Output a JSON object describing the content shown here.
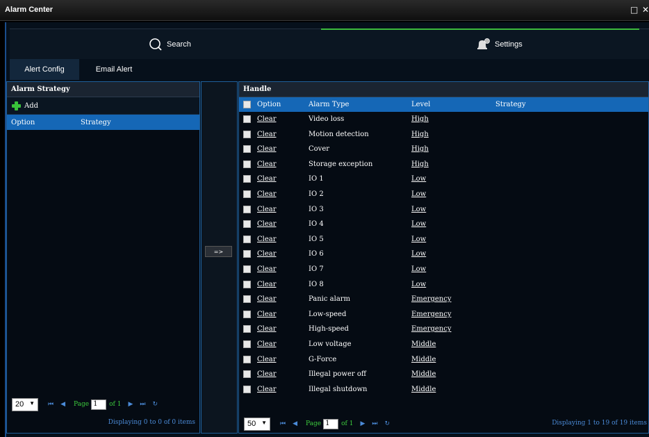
{
  "window": {
    "title": "Alarm Center",
    "maximize_glyph": "□",
    "close_glyph": "✕"
  },
  "nav": {
    "search_label": "Search",
    "settings_label": "Settings",
    "search_icon": "search-icon",
    "settings_icon": "bell-gear-icon",
    "active": "settings"
  },
  "tabs": [
    {
      "label": "Alert Config",
      "active": true
    },
    {
      "label": "Email Alert",
      "active": false
    }
  ],
  "left": {
    "title": "Alarm Strategy",
    "add_label": "Add",
    "columns": [
      "Option",
      "Strategy"
    ],
    "pager": {
      "page_size": "20",
      "page_label": "Page",
      "page": "1",
      "of": "of 1",
      "summary": "Displaying 0 to 0 of 0 items"
    }
  },
  "move_button": "=>",
  "right": {
    "title": "Handle",
    "columns": [
      "Option",
      "Alarm Type",
      "Level",
      "Strategy"
    ],
    "rows": [
      {
        "option": "Clear",
        "type": "Video loss",
        "level": "High"
      },
      {
        "option": "Clear",
        "type": "Motion detection",
        "level": "High"
      },
      {
        "option": "Clear",
        "type": "Cover",
        "level": "High"
      },
      {
        "option": "Clear",
        "type": "Storage exception",
        "level": "High"
      },
      {
        "option": "Clear",
        "type": "IO 1",
        "level": "Low"
      },
      {
        "option": "Clear",
        "type": "IO 2",
        "level": "Low"
      },
      {
        "option": "Clear",
        "type": "IO 3",
        "level": "Low"
      },
      {
        "option": "Clear",
        "type": "IO 4",
        "level": "Low"
      },
      {
        "option": "Clear",
        "type": "IO 5",
        "level": "Low"
      },
      {
        "option": "Clear",
        "type": "IO 6",
        "level": "Low"
      },
      {
        "option": "Clear",
        "type": "IO 7",
        "level": "Low"
      },
      {
        "option": "Clear",
        "type": "IO 8",
        "level": "Low"
      },
      {
        "option": "Clear",
        "type": "Panic alarm",
        "level": "Emergency"
      },
      {
        "option": "Clear",
        "type": "Low-speed",
        "level": "Emergency"
      },
      {
        "option": "Clear",
        "type": "High-speed",
        "level": "Emergency"
      },
      {
        "option": "Clear",
        "type": "Low voltage",
        "level": "Middle"
      },
      {
        "option": "Clear",
        "type": "G-Force",
        "level": "Middle"
      },
      {
        "option": "Clear",
        "type": "Illegal power off",
        "level": "Middle"
      },
      {
        "option": "Clear",
        "type": "Illegal shutdown",
        "level": "Middle"
      }
    ],
    "pager": {
      "page_size": "50",
      "page_label": "Page",
      "page": "1",
      "of": "of 1",
      "summary": "Displaying 1 to 19 of 19 items"
    }
  },
  "pager_icons": {
    "first": "⏮",
    "prev": "◀",
    "next": "▶",
    "last": "⏭",
    "refresh": "↻",
    "caret": "▼"
  },
  "colors": {
    "accent_blue": "#1567b6",
    "accent_green": "#3dbb3d",
    "panel_border": "#1f5f9a",
    "pager_text": "#4b8bd8"
  }
}
